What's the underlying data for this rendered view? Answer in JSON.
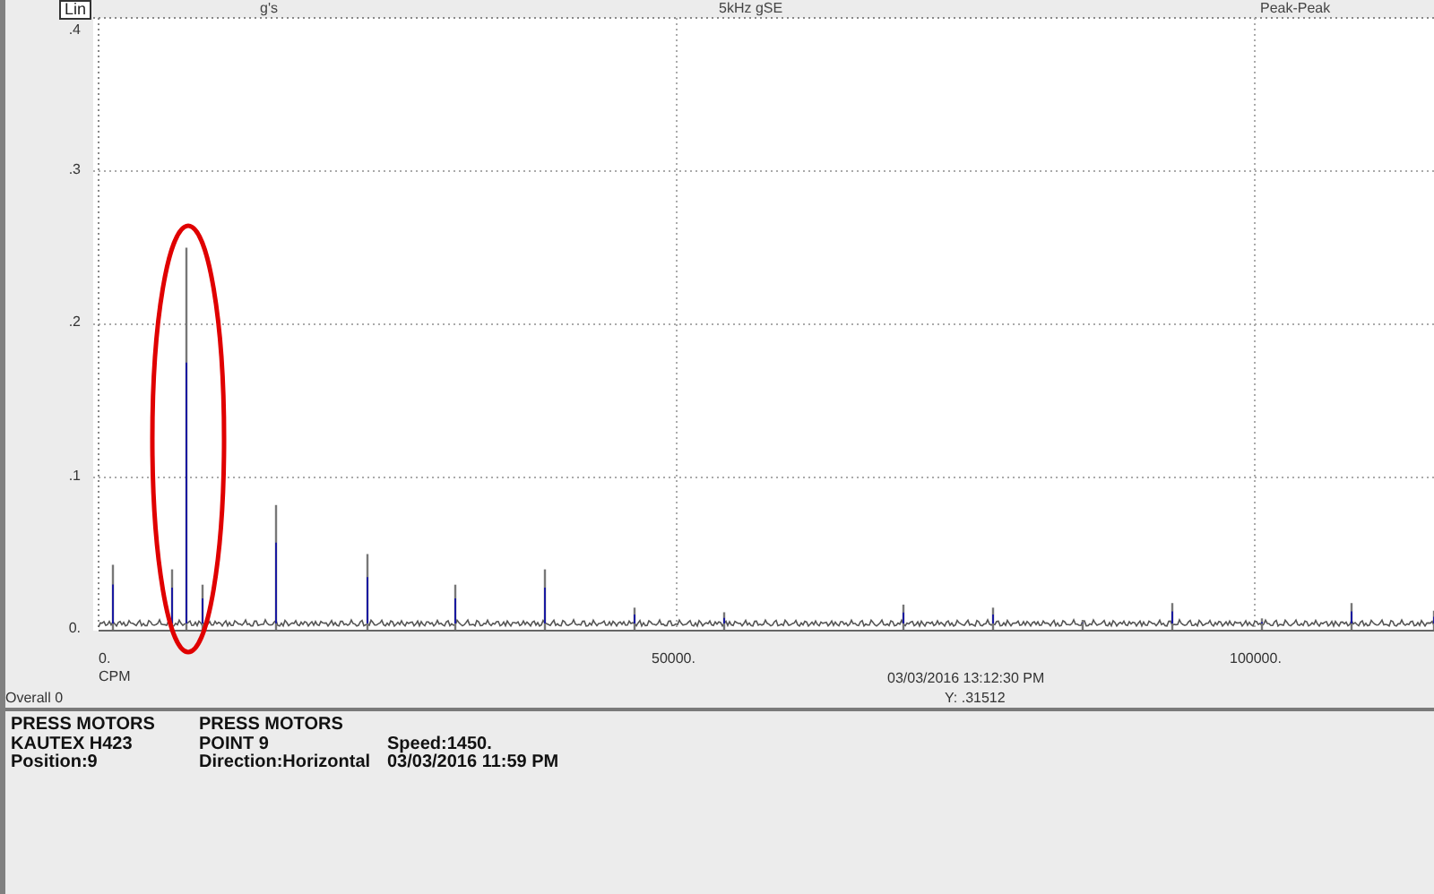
{
  "header": {
    "scale_button": "Lin",
    "units": "g's",
    "measurement": "5kHz gSE",
    "amplitude_type": "Peak-Peak"
  },
  "y_tick_labels": [
    ".4",
    ".3",
    ".2",
    ".1",
    "0."
  ],
  "x_tick_labels": [
    "0.",
    "50000.",
    "100000."
  ],
  "x_unit": "CPM",
  "cursor": {
    "timestamp": "03/03/2016 13:12:30 PM",
    "reading": "Y: .31512"
  },
  "overall": "Overall 0",
  "info_columns": [
    [
      "PRESS MOTORS",
      "KAUTEX H423",
      "Position:9"
    ],
    [
      "PRESS MOTORS",
      "POINT 9",
      "Direction:Horizontal"
    ],
    [
      "Speed:1450.",
      "03/03/2016 11:59 PM"
    ]
  ]
}
